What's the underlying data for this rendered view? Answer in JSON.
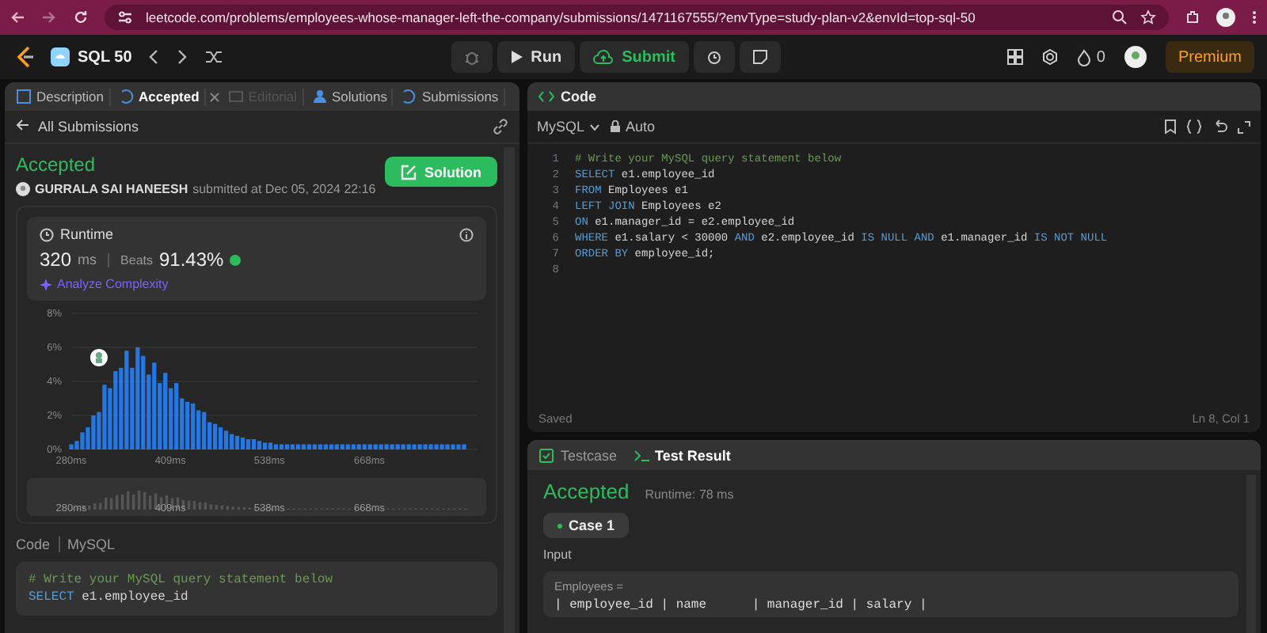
{
  "browser": {
    "url": "leetcode.com/problems/employees-whose-manager-left-the-company/submissions/1471167555/?envType=study-plan-v2&envId=top-sql-50"
  },
  "navbar": {
    "study_plan": "SQL 50",
    "run": "Run",
    "submit": "Submit",
    "streak": "0",
    "premium": "Premium"
  },
  "left_tabs": [
    {
      "label": "Description",
      "selected": false,
      "disabled": false,
      "closable": false
    },
    {
      "label": "Accepted",
      "selected": true,
      "disabled": false,
      "closable": true
    },
    {
      "label": "Editorial",
      "selected": false,
      "disabled": true,
      "closable": false
    },
    {
      "label": "Solutions",
      "selected": false,
      "disabled": false,
      "closable": false
    },
    {
      "label": "Submissions",
      "selected": false,
      "disabled": false,
      "closable": false
    }
  ],
  "submission": {
    "back": "All Submissions",
    "status": "Accepted",
    "user": "GURRALA SAI HANEESH",
    "submitted": "submitted at Dec 05, 2024 22:16",
    "solution_button": "Solution",
    "runtime_title": "Runtime",
    "runtime_value": "320",
    "runtime_unit": "ms",
    "beats_label": "Beats",
    "beats_value": "91.43%",
    "analyze": "Analyze Complexity",
    "chart_data": {
      "type": "bar",
      "values": [
        0.3,
        0.5,
        1.0,
        1.3,
        2.0,
        2.2,
        3.8,
        3.6,
        4.6,
        4.8,
        5.8,
        4.8,
        6.0,
        5.5,
        4.4,
        5.1,
        3.9,
        4.5,
        3.6,
        3.9,
        3.0,
        2.8,
        2.7,
        2.3,
        2.2,
        1.6,
        1.5,
        1.3,
        1.1,
        0.9,
        0.8,
        0.7,
        0.6,
        0.6,
        0.5,
        0.4,
        0.4,
        0.3,
        0.3,
        0.3,
        0.3,
        0.3,
        0.3,
        0.3,
        0.3,
        0.3,
        0.3,
        0.3,
        0.3,
        0.3,
        0.3,
        0.3,
        0.3,
        0.3,
        0.3,
        0.3,
        0.3,
        0.3,
        0.3,
        0.3,
        0.3,
        0.3,
        0.3,
        0.3,
        0.3,
        0.3,
        0.3,
        0.3,
        0.3,
        0.3,
        0.3,
        0.3
      ],
      "ylim": [
        0,
        8
      ],
      "yticks": [
        {
          "value": 0,
          "label": "0%"
        },
        {
          "value": 2,
          "label": "2%"
        },
        {
          "value": 4,
          "label": "4%"
        },
        {
          "value": 6,
          "label": "6%"
        },
        {
          "value": 8,
          "label": "8%"
        }
      ],
      "x": [
        280,
        287.2,
        294.4,
        301.6,
        308.8,
        316,
        323.2,
        330.4,
        337.6,
        344.8,
        352,
        359.2,
        366.4,
        373.6,
        380.8,
        388,
        395.2,
        402.4,
        409.6,
        416.8,
        424,
        431.2,
        438.4,
        445.6,
        452.8,
        460,
        467.2,
        474.4,
        481.6,
        488.8,
        496,
        503.2,
        510.4,
        517.6,
        524.8,
        532,
        539.2,
        546.4,
        553.6,
        560.8,
        568,
        575.2,
        582.4,
        589.6,
        596.8,
        604,
        611.2,
        618.4,
        625.6,
        632.8,
        640,
        647.2,
        654.4,
        661.6,
        668.8,
        676,
        683.2,
        690.4,
        697.6,
        704.8,
        712,
        719.2,
        726.4,
        733.6,
        740.8,
        748,
        755.2,
        762.4,
        769.6,
        776.8,
        784,
        791.2
      ],
      "xlim": [
        280,
        791.2
      ],
      "xticks": [
        {
          "value": 280,
          "label": "280ms"
        },
        {
          "value": 409,
          "label": "409ms"
        },
        {
          "value": 538,
          "label": "538ms"
        },
        {
          "value": 668,
          "label": "668ms"
        }
      ],
      "grid": true
    },
    "overview_labels": [
      "280ms",
      "409ms",
      "538ms",
      "668ms"
    ],
    "code_label": "Code",
    "code_language": "MySQL",
    "code_lines": [
      [
        {
          "text": "# Write your MySQL query statement below",
          "kind": "comment"
        }
      ],
      [
        {
          "text": "SELECT",
          "kind": "keyword"
        },
        {
          "text": " e1.employee_id",
          "kind": "plain"
        }
      ]
    ]
  },
  "editor": {
    "title": "Code",
    "language": "MySQL",
    "mode": "Auto",
    "status": "Saved",
    "cursor": "Ln 8, Col 1",
    "lines": [
      {
        "number": "1",
        "tokens": [
          {
            "text": "# Write your MySQL query statement below",
            "kind": "comment"
          }
        ]
      },
      {
        "number": "2",
        "tokens": [
          {
            "text": "SELECT",
            "kind": "keyword"
          },
          {
            "text": " e1.employee_id",
            "kind": "plain"
          }
        ]
      },
      {
        "number": "3",
        "tokens": [
          {
            "text": "FROM",
            "kind": "keyword"
          },
          {
            "text": " Employees e1",
            "kind": "plain"
          }
        ]
      },
      {
        "number": "4",
        "tokens": [
          {
            "text": "LEFT JOIN",
            "kind": "keyword"
          },
          {
            "text": " Employees e2",
            "kind": "plain"
          }
        ]
      },
      {
        "number": "5",
        "tokens": [
          {
            "text": "ON",
            "kind": "keyword"
          },
          {
            "text": " e1.manager_id = e2.employee_id",
            "kind": "plain"
          }
        ]
      },
      {
        "number": "6",
        "tokens": [
          {
            "text": "WHERE",
            "kind": "keyword"
          },
          {
            "text": " e1.salary < 30000 ",
            "kind": "plain"
          },
          {
            "text": "AND",
            "kind": "keyword"
          },
          {
            "text": " e2.employee_id ",
            "kind": "plain"
          },
          {
            "text": "IS NULL AND",
            "kind": "keyword"
          },
          {
            "text": " e1.manager_id ",
            "kind": "plain"
          },
          {
            "text": "IS NOT NULL",
            "kind": "keyword"
          }
        ]
      },
      {
        "number": "7",
        "tokens": [
          {
            "text": "ORDER BY",
            "kind": "keyword"
          },
          {
            "text": " employee_id;",
            "kind": "plain"
          }
        ]
      },
      {
        "number": "8"
      }
    ]
  },
  "result": {
    "tabs": [
      {
        "label": "Testcase",
        "selected": false
      },
      {
        "label": "Test Result",
        "selected": true
      }
    ],
    "status": "Accepted",
    "runtime": "Runtime: 78 ms",
    "cases": [
      {
        "label": "Case 1",
        "selected": true
      }
    ],
    "input_label": "Input",
    "input_name": "Employees =",
    "input_first_line": "| employee_id | name      | manager_id | salary |"
  }
}
